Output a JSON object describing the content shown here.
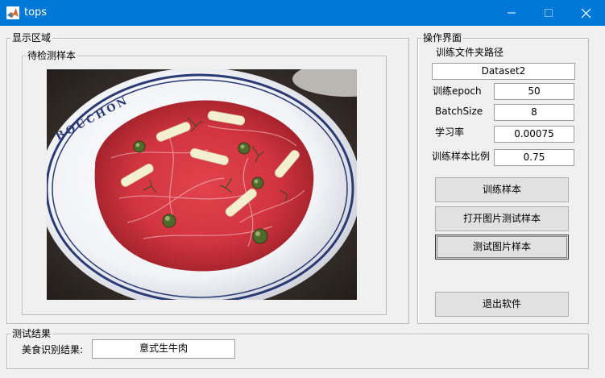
{
  "window": {
    "title": "tops"
  },
  "display_panel": {
    "legend": "显示区域",
    "image_panel": {
      "legend": "待检测样本"
    },
    "image_plate_text": "BOUCHON"
  },
  "ops_panel": {
    "legend": "操作界面",
    "folder_label": "训练文件夹路径",
    "folder_value": "Dataset2",
    "params": [
      {
        "label": "训练epoch",
        "value": "50"
      },
      {
        "label": "BatchSize",
        "value": "8"
      },
      {
        "label": "学习率",
        "value": "0.00075"
      },
      {
        "label": "训练样本比例",
        "value": "0.75"
      }
    ],
    "buttons": {
      "train": "训练样本",
      "open_image": "打开图片测试样本",
      "test_image": "测试图片样本",
      "exit": "退出软件"
    }
  },
  "result_panel": {
    "legend": "测试结果",
    "label": "美食识别结果:",
    "value": "意式生牛肉"
  }
}
